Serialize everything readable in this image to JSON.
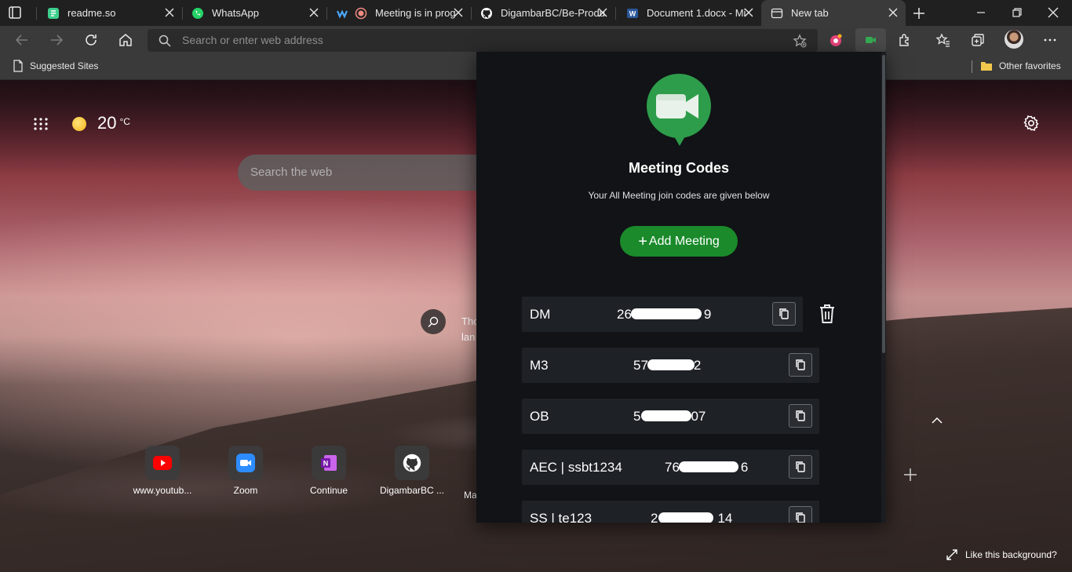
{
  "tabs": [
    {
      "label": "readme.so",
      "icon": "readme-icon"
    },
    {
      "label": "WhatsApp",
      "icon": "whatsapp-icon"
    },
    {
      "label": "Meeting is in prog",
      "icon": "meeting-icon"
    },
    {
      "label": "DigambarBC/Be-Produ",
      "icon": "github-icon"
    },
    {
      "label": "Document 1.docx - Mi",
      "icon": "word-icon"
    },
    {
      "label": "New tab",
      "icon": "newtab-icon"
    }
  ],
  "address_bar": {
    "placeholder": "Search or enter web address"
  },
  "bookmarks": {
    "suggested": "Suggested Sites",
    "other": "Other favorites"
  },
  "newtab": {
    "temperature": "20",
    "unit": "°C",
    "search_placeholder": "Search the web",
    "lens_text_line1": "Tho",
    "lens_text_line2": "lan",
    "quick_links": [
      {
        "label": "www.youtub...",
        "icon": "youtube-icon"
      },
      {
        "label": "Zoom",
        "icon": "zoom-icon"
      },
      {
        "label": "Continue",
        "icon": "onenote-icon"
      },
      {
        "label": "DigambarBC ...",
        "icon": "github-icon"
      },
      {
        "label": "Ma",
        "icon": "blank-icon"
      }
    ],
    "like_background": "Like this background?"
  },
  "popup": {
    "title": "Meeting Codes",
    "subtitle": "Your All Meeting join codes are given below",
    "add_button": "Add Meeting",
    "add_button_plus": "+",
    "rows": [
      {
        "name": "DM",
        "code_start": "26",
        "code_end": "9"
      },
      {
        "name": "M3",
        "code_start": "57",
        "code_end": "2"
      },
      {
        "name": "OB",
        "code_start": "5",
        "code_end": "07"
      },
      {
        "name": "AEC | ssbt1234",
        "code_start": "76",
        "code_end": "6"
      },
      {
        "name": "SS | te123",
        "code_start": "2",
        "code_end": "14"
      }
    ]
  },
  "colors": {
    "accent_green": "#1a8a2a",
    "meet_green": "#34a853",
    "popup_bg": "#111316",
    "row_bg": "#1e2126"
  }
}
